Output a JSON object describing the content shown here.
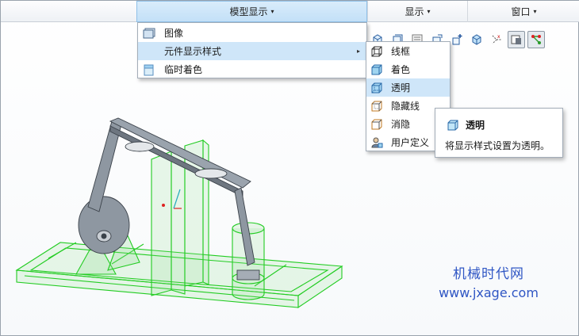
{
  "menubar": {
    "tabs": [
      {
        "label": "模型显示",
        "caret": "▾",
        "active": true
      },
      {
        "label": "显示",
        "caret": "▾",
        "active": false
      },
      {
        "label": "窗口",
        "caret": "▾",
        "active": false
      }
    ]
  },
  "dropdown": {
    "items": [
      {
        "label": "图像",
        "icon": "image-icon"
      },
      {
        "label": "元件显示样式",
        "icon": "none",
        "has_submenu": true,
        "arrow": "▸"
      },
      {
        "label": "临时着色",
        "icon": "temp-shade-icon"
      }
    ]
  },
  "submenu": {
    "items": [
      {
        "label": "线框",
        "icon": "wireframe-icon"
      },
      {
        "label": "着色",
        "icon": "shaded-icon"
      },
      {
        "label": "透明",
        "icon": "transparent-icon",
        "highlighted": true
      },
      {
        "label": "隐藏线",
        "icon": "hidden-line-icon"
      },
      {
        "label": "消隐",
        "icon": "no-hidden-icon"
      },
      {
        "label": "用户定义",
        "icon": "user-defined-icon"
      }
    ]
  },
  "tooltip": {
    "title": "透明",
    "description": "将显示样式设置为透明。"
  },
  "toolbar": {
    "icons": [
      "view-cube-icon",
      "refit-icon",
      "named-views-icon",
      "reorient-icon",
      "spin-center-icon",
      "display-style-icon",
      "datum-display-icon",
      "layer-toggle-icon",
      "connector-icon"
    ]
  },
  "watermark": {
    "name": "机械时代网",
    "url": "www.jxage.com"
  },
  "colors": {
    "accent": "#cfe6f9",
    "model_green": "#22cc22",
    "model_gray": "#6e7680",
    "watermark_blue": "#2f56c4"
  }
}
